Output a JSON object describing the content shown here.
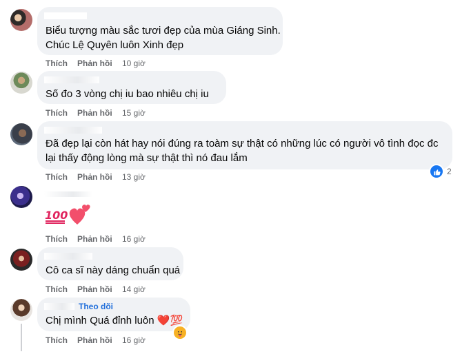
{
  "comments": [
    {
      "text_lines": [
        "Biểu tượng màu sắc tươi đẹp của mùa Giáng Sinh.",
        "Chúc Lệ Quyên luôn Xinh đẹp"
      ],
      "like": "Thích",
      "reply": "Phản hồi",
      "time": "10 giờ"
    },
    {
      "text_lines": [
        "Số đo 3 vòng chị iu bao nhiêu chị iu"
      ],
      "like": "Thích",
      "reply": "Phản hồi",
      "time": "15 giờ"
    },
    {
      "text_lines": [
        "Đã đẹp lại còn hát hay nói đúng ra toàm sự thật có những lúc có người vô tình đọc đc",
        "lại thấy động lòng mà sự thật thì nó đau lắm"
      ],
      "like": "Thích",
      "reply": "Phản hồi",
      "time": "13 giờ",
      "reaction_count": "2"
    },
    {
      "emoji": "💯❤️",
      "like": "Thích",
      "reply": "Phản hồi",
      "time": "16 giờ"
    },
    {
      "text_lines": [
        "Cô ca sĩ này dáng chuẩn quá"
      ],
      "like": "Thích",
      "reply": "Phản hồi",
      "time": "14 giờ"
    },
    {
      "follow": "Theo dõi",
      "text_lines": [
        "Chị mình Quá đỉnh luôn ❤️💯"
      ],
      "like": "Thích",
      "reply": "Phản hồi",
      "time": "16 giờ"
    }
  ],
  "colors": {
    "bubble": "#f0f2f5",
    "meta": "#65676b",
    "link": "#216fdb",
    "like_blue": "#1877f2"
  }
}
